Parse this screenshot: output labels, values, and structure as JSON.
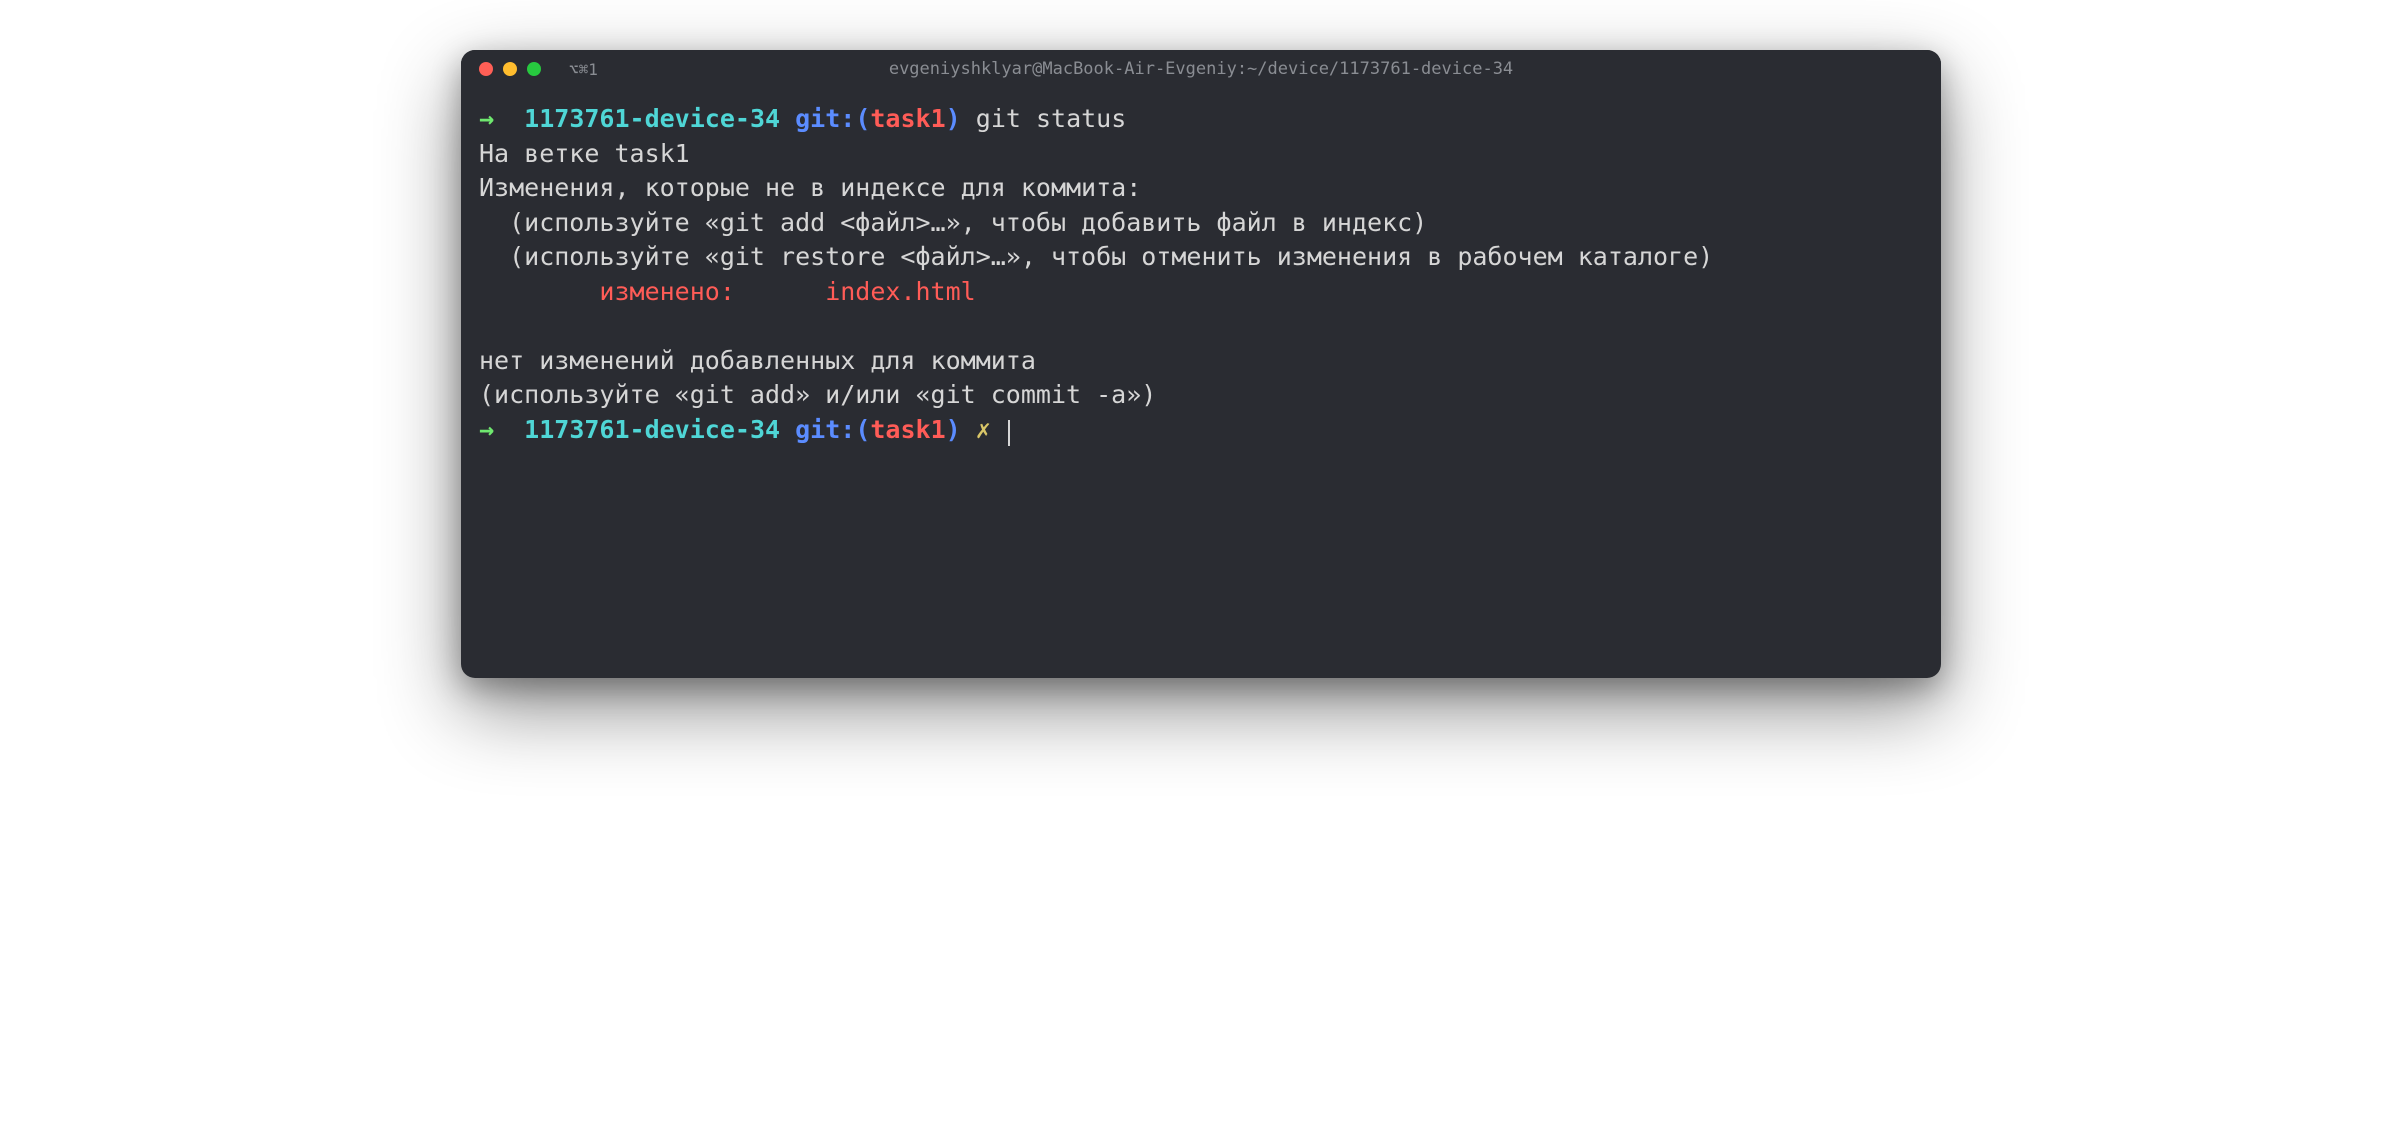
{
  "titleBar": {
    "tabLabel": "⌥⌘1",
    "windowTitle": "evgeniyshklyar@MacBook-Air-Evgeniy:~/device/1173761-device-34"
  },
  "prompt1": {
    "arrow": "→",
    "folder": "1173761-device-34",
    "gitPrefix": "git:(",
    "branch": "task1",
    "gitSuffix": ")",
    "command": "git status"
  },
  "output": {
    "line1": "На ветке task1",
    "line2": "Изменения, которые не в индексе для коммита:",
    "line3": "  (используйте «git add <файл>…», чтобы добавить файл в индекс)",
    "line4": "  (используйте «git restore <файл>…», чтобы отменить изменения в рабочем каталоге)",
    "modifiedLabel": "        изменено:      ",
    "modifiedFile": "index.html",
    "line6": "нет изменений добавленных для коммита",
    "line7": "(используйте «git add» и/или «git commit -a»)"
  },
  "prompt2": {
    "arrow": "→",
    "folder": "1173761-device-34",
    "gitPrefix": "git:(",
    "branch": "task1",
    "gitSuffix": ")",
    "dirty": "✗"
  }
}
